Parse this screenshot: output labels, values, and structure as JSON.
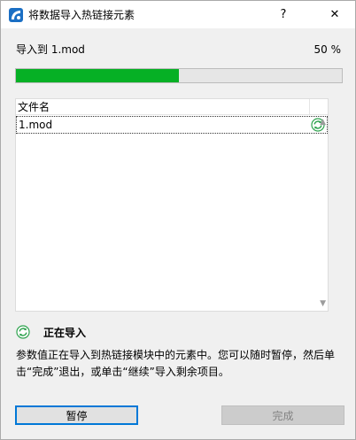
{
  "window": {
    "title": "将数据导入热链接元素",
    "help_label": "?",
    "close_label": "✕",
    "accent_color": "#0078d7"
  },
  "import": {
    "label": "导入到 1.mod",
    "percent_text": "50 %",
    "progress_fraction": 0.5,
    "progress_color": "#06b025"
  },
  "list": {
    "header": "文件名",
    "rows": [
      {
        "name": "1.mod",
        "status_icon": "sync-icon"
      }
    ]
  },
  "status": {
    "icon": "sync-icon",
    "title": "正在导入",
    "description": "参数值正在导入到热链接模块中的元素中。您可以随时暂停，然后单击“完成”退出，或单击“继续”导入剩余项目。"
  },
  "buttons": {
    "pause": "暂停",
    "done": "完成"
  }
}
